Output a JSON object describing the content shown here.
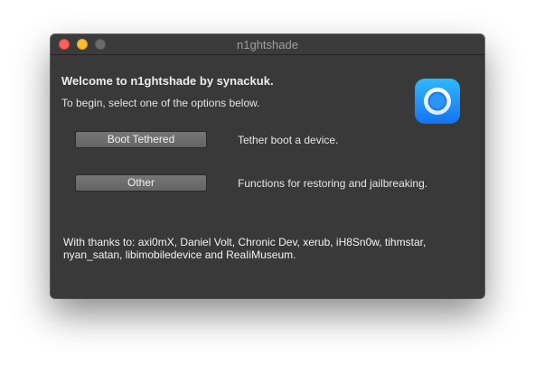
{
  "window": {
    "title": "n1ghtshade"
  },
  "main": {
    "welcome": "Welcome to n1ghtshade by synackuk.",
    "instruction": "To begin, select one of the options below.",
    "app_icon": "n1ghtshade-app-icon",
    "options": [
      {
        "button_label": "Boot Tethered",
        "description": "Tether boot a device."
      },
      {
        "button_label": "Other",
        "description": "Functions for restoring and jailbreaking."
      }
    ],
    "thanks": "With thanks to: axi0mX, Daniel Volt, Chronic Dev, xerub, iH8Sn0w, tihmstar, nyan_satan, libimobiledevice and ReaIiMuseum."
  },
  "colors": {
    "window_bg": "#393939",
    "close": "#fe5f57",
    "minimize": "#febc2e",
    "zoom_disabled": "#6a6a6a",
    "icon_blue": "#1e8fff"
  }
}
